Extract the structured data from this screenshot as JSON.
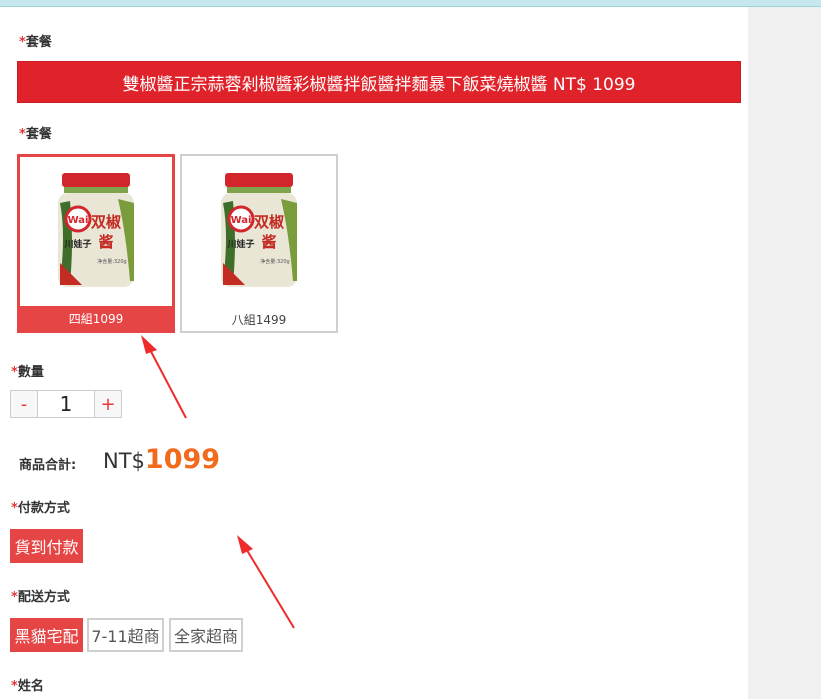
{
  "package_label": "套餐",
  "banner_text": "雙椒醬正宗蒜蓉剁椒醬彩椒醬拌飯醬拌麵暴下飯菜燒椒醬 NT$ 1099",
  "package_options_label": "套餐",
  "package_options": [
    {
      "caption": "四組1099",
      "selected": true
    },
    {
      "caption": "八組1499",
      "selected": false
    }
  ],
  "jar": {
    "brand_badge": "Wai",
    "name_line1": "双椒",
    "name_line2": "酱",
    "brand_name": "川娃子",
    "net": "净含量:320g"
  },
  "quantity_label": "數量",
  "quantity": {
    "minus": "-",
    "value": "1",
    "plus": "+"
  },
  "total_label": "商品合計:",
  "total_currency": "NT$",
  "total_amount": "1099",
  "payment_label": "付款方式",
  "payment_options": [
    {
      "label": "貨到付款",
      "selected": true
    }
  ],
  "shipping_label": "配送方式",
  "shipping_options": [
    {
      "label": "黑貓宅配",
      "selected": true
    },
    {
      "label": "7-11超商",
      "selected": false
    },
    {
      "label": "全家超商",
      "selected": false
    }
  ],
  "name_label": "姓名",
  "required_mark": "*",
  "colors": {
    "accent_red": "#e0232a",
    "selected_red": "#e64545",
    "price_orange": "#f26b1d"
  }
}
